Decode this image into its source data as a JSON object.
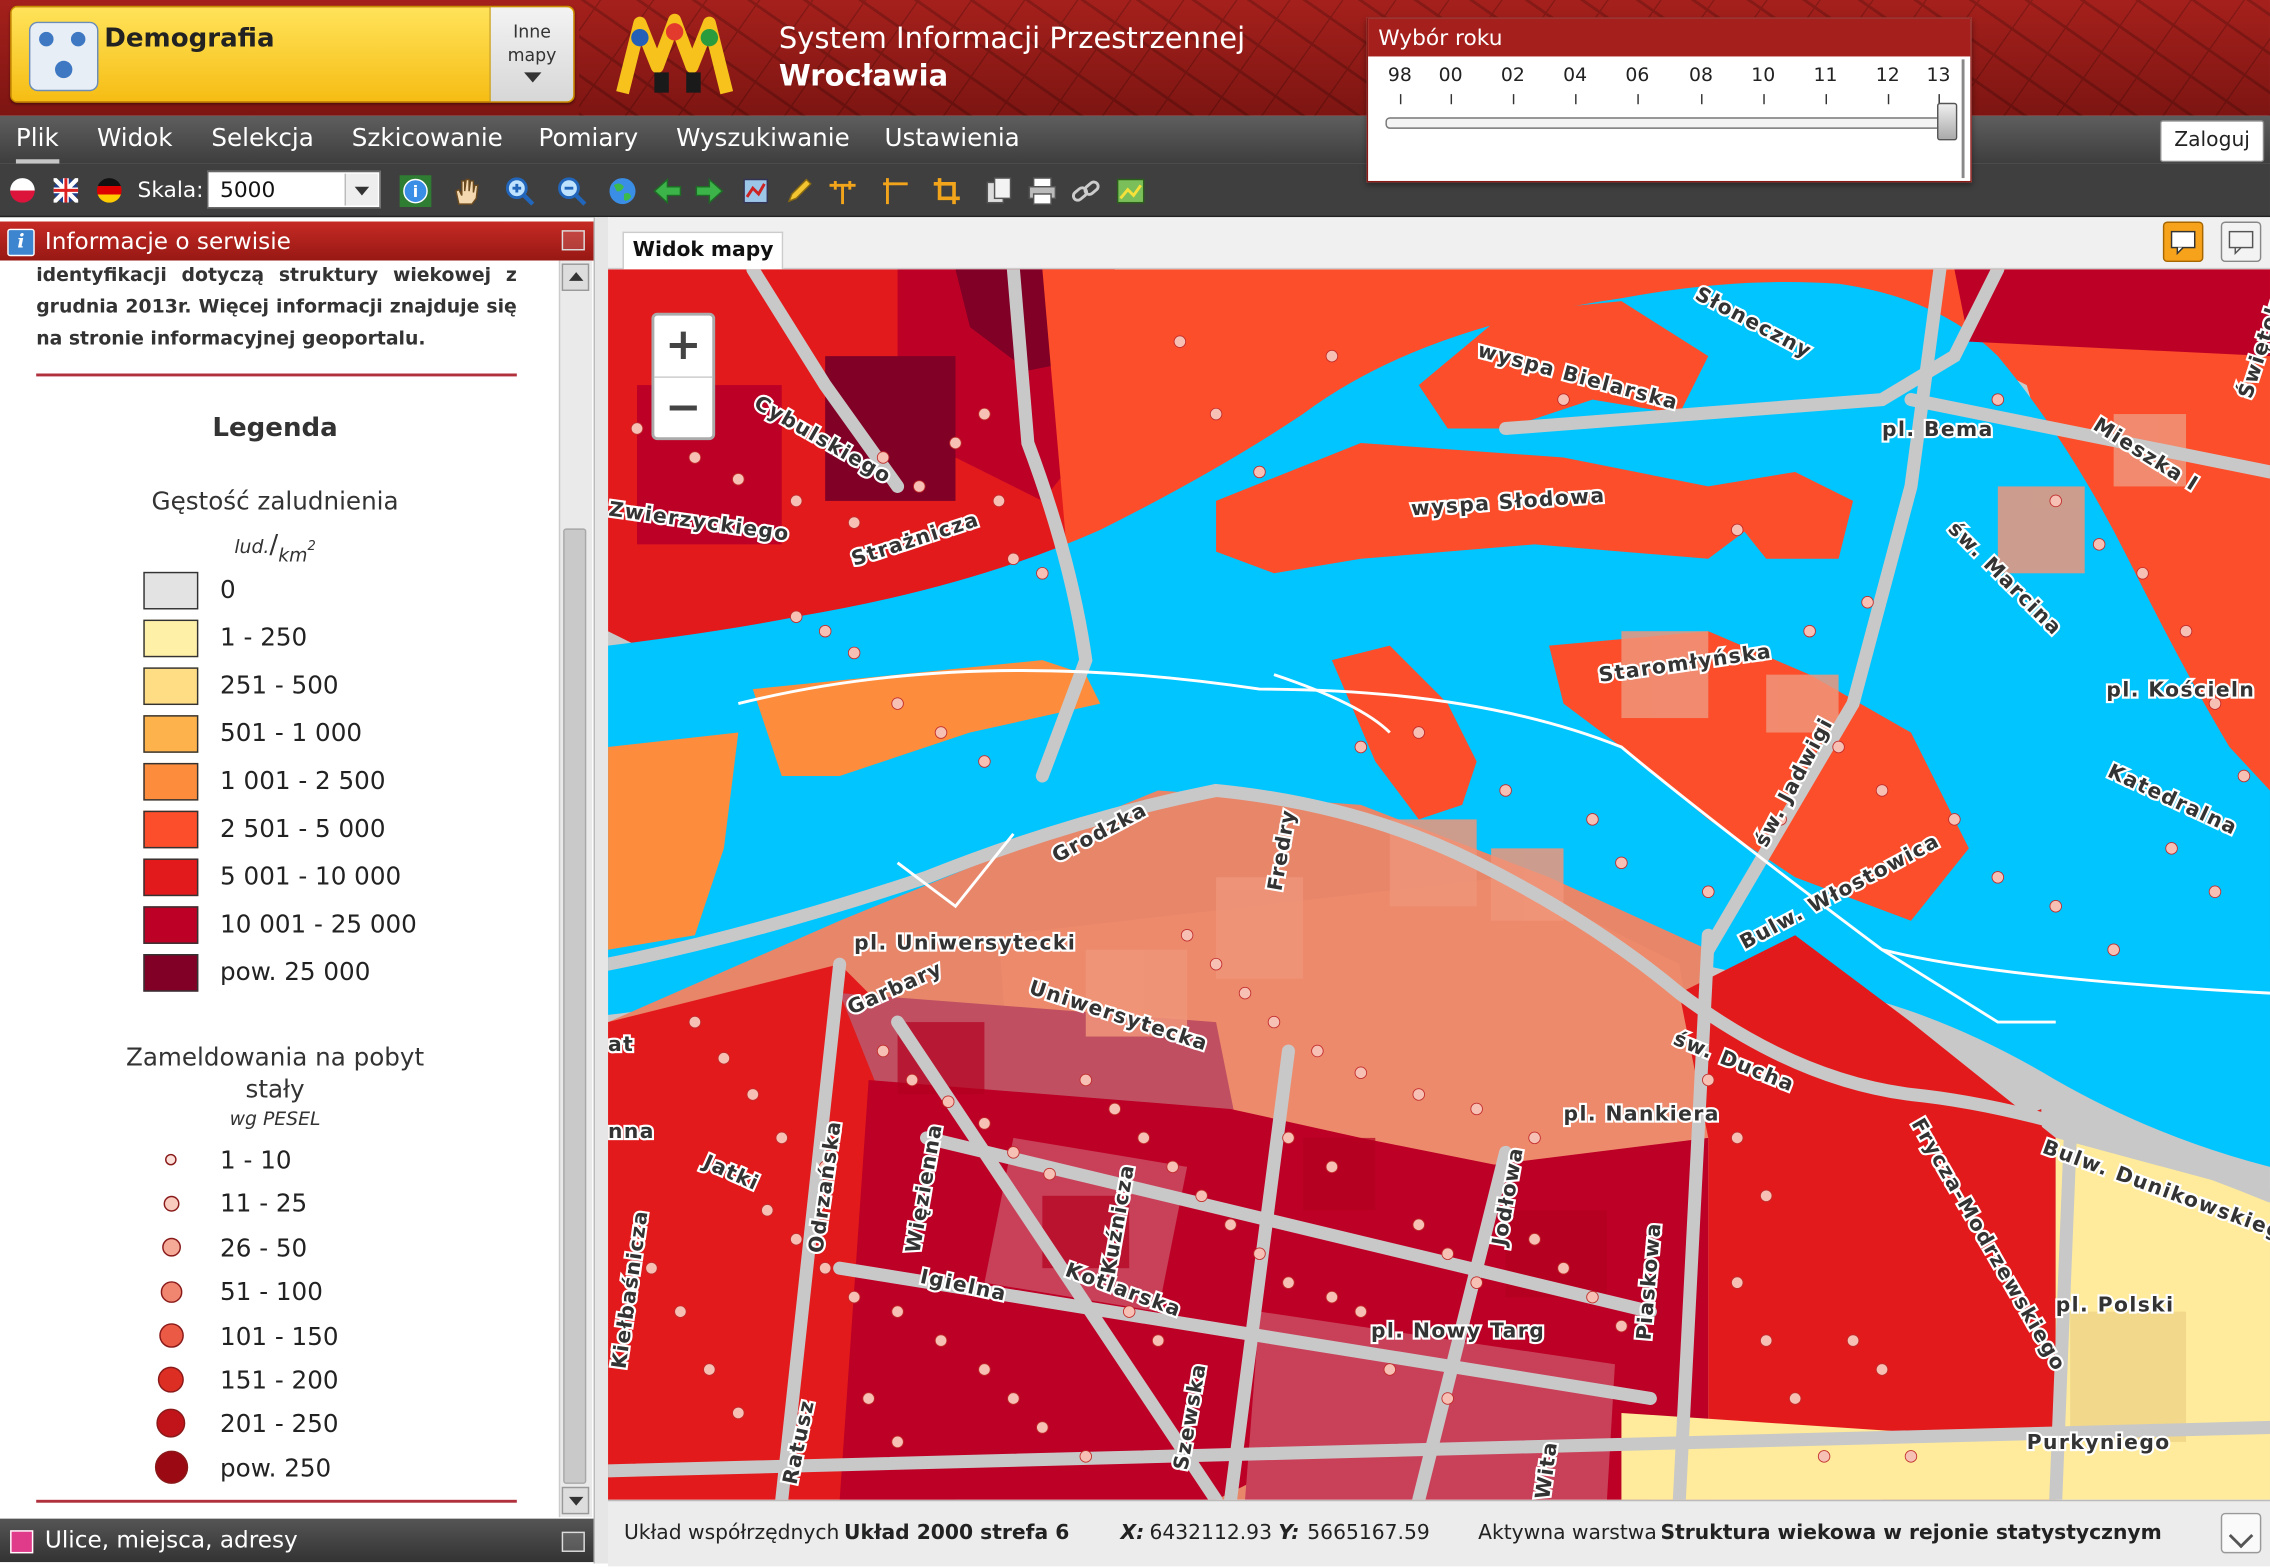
{
  "header": {
    "app_title": "Demografia",
    "other_maps_label": "Inne mapy",
    "system_line1": "System Informacji Przestrzennej",
    "system_line2": "Wrocławia"
  },
  "year_picker": {
    "title": "Wybór roku",
    "years": [
      "98",
      "00",
      "02",
      "04",
      "06",
      "08",
      "10",
      "11",
      "12",
      "13"
    ],
    "selected": "13"
  },
  "menu": {
    "items": [
      "Plik",
      "Widok",
      "Selekcja",
      "Szkicowanie",
      "Pomiary",
      "Wyszukiwanie",
      "Ustawienia"
    ],
    "active": "Plik",
    "login_label": "Zaloguj"
  },
  "toolbar": {
    "scale_label": "Skala:",
    "scale_value": "5000",
    "languages": [
      "pl",
      "en",
      "de"
    ],
    "tools": [
      "info-icon",
      "pan-hand-icon",
      "zoom-in-icon",
      "zoom-out-icon",
      "globe-icon",
      "back-arrow-icon",
      "forward-arrow-icon",
      "map-export-icon",
      "pencil-icon",
      "measure-distance-icon",
      "measure-angle-icon",
      "crop-icon",
      "copy-icon",
      "print-icon",
      "link-icon",
      "image-export-icon"
    ]
  },
  "info_panel": {
    "title": "Informacje o serwisie",
    "intro_text": "identyfikacji dotyczą struktury wiekowej z grudnia 2013r. Więcej informacji znajduje się na stronie informacyjnej geoportalu.",
    "legend_title": "Legenda",
    "density": {
      "title": "Gęstość zaludnienia",
      "unit_num": "lud.",
      "unit_den": "km",
      "unit_exp": "2",
      "classes": [
        {
          "label": "0",
          "color": "#e3e3e3"
        },
        {
          "label": "1 - 250",
          "color": "#fff0a8"
        },
        {
          "label": "251 - 500",
          "color": "#ffdd85"
        },
        {
          "label": "501 - 1 000",
          "color": "#feb24c"
        },
        {
          "label": "1 001 - 2 500",
          "color": "#fd8d3c"
        },
        {
          "label": "2 501 - 5 000",
          "color": "#fc4e2a"
        },
        {
          "label": "5 001 - 10 000",
          "color": "#e31a1c"
        },
        {
          "label": "10 001 - 25 000",
          "color": "#bd0026"
        },
        {
          "label": "pow. 25 000",
          "color": "#800026"
        }
      ]
    },
    "registrations": {
      "title_line1": "Zameldowania na pobyt",
      "title_line2": "stały",
      "subtitle": "wg PESEL",
      "classes": [
        "1 - 10",
        "11 - 25",
        "26 - 50",
        "51 - 100",
        "101 - 150",
        "151 - 200",
        "201 - 250",
        "pow. 250"
      ]
    }
  },
  "bottom_panel": {
    "title": "Ulice, miejsca, adresy"
  },
  "map": {
    "tab_label": "Widok mapy",
    "zoom_in": "+",
    "zoom_out": "−",
    "labels": {
      "wyspa_bielarska": "wyspa Bielarska",
      "wyspa_slodowa": "wyspa Słodowa",
      "sloneczny": "Słoneczny",
      "pl_bema": "pl. Bema",
      "mieszka": "Mieszka I",
      "sw_marcina": "św. Marcina",
      "swietokrzyska": "Świętokrz",
      "pl_koscielny": "pl. Kościeln",
      "katedralna": "Katedralna",
      "staromlynska": "Staromłyńska",
      "sw_jadwigi": "św. Jadwigi",
      "bulw_wlostowica": "Bulw. Włostowica",
      "cybulskiego": "Cybulskiego",
      "zwierzynieckiego": "Zwierzyckiego",
      "straznicza": "Strażnicza",
      "grodzka": "Grodzka",
      "fredry": "Fredry",
      "pl_uniwersytecki": "pl. Uniwersytecki",
      "uniwersytecka": "Uniwersytecka",
      "garbary": "Garbary",
      "sw_ducha": "św. Ducha",
      "pl_nankiera": "pl. Nankiera",
      "bulw_dunikowskiego": "Bulw. Dunikowskiego",
      "frycza": "Frycza-Modrzewskiego",
      "pl_polski": "pl. Polski",
      "purkyniego": "Purkyniego",
      "jatki": "Jatki",
      "odrzanska": "Odrzańska",
      "wiezienna": "Więzienna",
      "kuznicza": "Kuźnicza",
      "kotlarska": "Kotlarska",
      "igielna": "Igielna",
      "jodlowa": "Jodłowa",
      "pl_nowy_targ": "pl. Nowy Targ",
      "piaskowa": "Piaskowa",
      "szewska": "Szewska",
      "ratusz": "Ratusz",
      "kielbasnicza": "Kiełbaśnicza",
      "wita": "Wita",
      "at": "at",
      "nna": "nna"
    }
  },
  "status_bar": {
    "crs_label": "Układ współrzędnych",
    "crs_value": "Układ 2000 strefa 6",
    "x_label": "X:",
    "x_value": "6432112.93",
    "y_label": "Y:",
    "y_value": "5665167.59",
    "layer_label": "Aktywna warstwa",
    "layer_value": "Struktura wiekowa w rejonie statystycznym"
  },
  "colors": {
    "header_red": "#a5201c",
    "water": "#00c5ff",
    "road": "#c8c8c8"
  }
}
